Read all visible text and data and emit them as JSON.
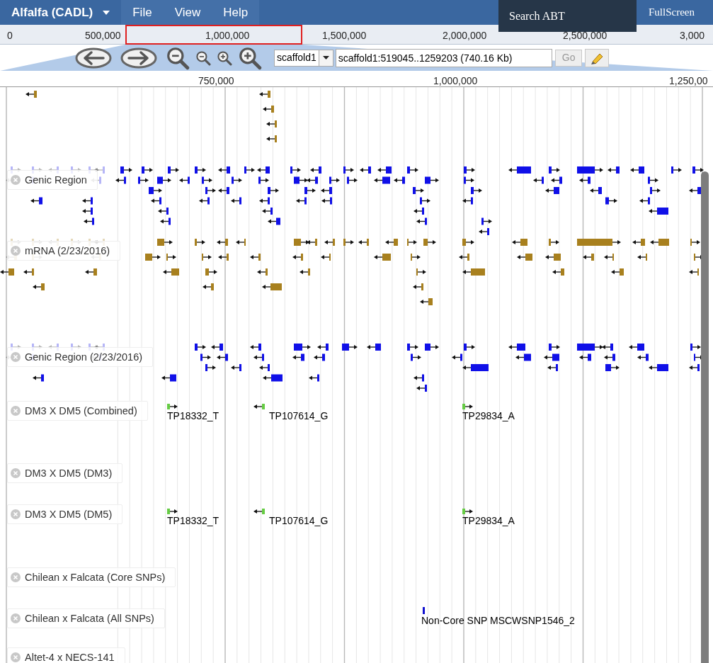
{
  "menu_bar": {
    "dataset": "Alfalfa (CADL)",
    "menus": [
      "File",
      "View",
      "Help"
    ],
    "fullscreen": "FullScreen"
  },
  "search_popup": {
    "label": "Search ABT"
  },
  "overview": {
    "ticks": [
      "0",
      "500,000",
      "1,000,000",
      "1,500,000",
      "2,000,000",
      "2,500,000",
      "3,000"
    ]
  },
  "navigation": {
    "reference": "scaffold1",
    "location": "scaffold1:519045..1259203 (740.16 Kb)",
    "go": "Go"
  },
  "ruler": {
    "ticks": [
      "750,000",
      "1,000,000",
      "1,250,00"
    ]
  },
  "tracks": [
    {
      "kind": "mrna"
    },
    {
      "kind": "genes",
      "label": "Genic Region"
    },
    {
      "kind": "mrna",
      "label": "mRNA (2/23/2016)"
    },
    {
      "kind": "genes",
      "label": "Genic Region (2/23/2016)"
    },
    {
      "kind": "markers",
      "label": "DM3 X DM5 (Combined)",
      "features": [
        {
          "label": "TP18332_T"
        },
        {
          "label": "TP107614_G"
        },
        {
          "label": "TP29834_A"
        }
      ]
    },
    {
      "kind": "markers",
      "label": "DM3 X DM5 (DM3)"
    },
    {
      "kind": "markers",
      "label": "DM3 X DM5 (DM5)",
      "features": [
        {
          "label": "TP18332_T"
        },
        {
          "label": "TP107614_G"
        },
        {
          "label": "TP29834_A"
        }
      ]
    },
    {
      "kind": "snps",
      "label": "Chilean x Falcata (Core SNPs)"
    },
    {
      "kind": "snps",
      "label": "Chilean x Falcata (All SNPs)",
      "features": [
        {
          "label": "Non-Core SNP MSCWSNP1546_2"
        }
      ]
    },
    {
      "kind": "snps",
      "label": "Altet-4 x NECS-141"
    }
  ]
}
